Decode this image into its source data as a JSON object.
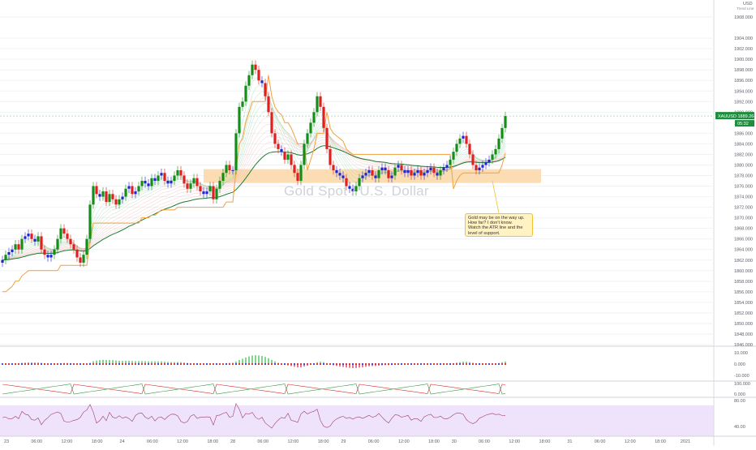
{
  "chart_data": {
    "type": "candlestick",
    "symbol": "XAUUSD",
    "watermark": "Gold Spot / U.S. Dollar",
    "currency": "USD",
    "mode_label": "Trend Line",
    "last_price": "1889.264",
    "countdown": "05:32",
    "ylim": [
      1846,
      1910
    ],
    "y_ticks": [
      "1908.000",
      "1904.000",
      "1902.000",
      "1900.000",
      "1898.000",
      "1896.000",
      "1894.000",
      "1892.000",
      "1890.000",
      "1888.000",
      "1886.000",
      "1884.000",
      "1882.000",
      "1880.000",
      "1878.000",
      "1876.000",
      "1874.000",
      "1872.000",
      "1870.000",
      "1868.000",
      "1866.000",
      "1864.000",
      "1862.000",
      "1860.000",
      "1858.000",
      "1856.000",
      "1854.000",
      "1852.000",
      "1850.000",
      "1848.000",
      "1846.000"
    ],
    "x_ticks": [
      {
        "label": "23",
        "i": 0
      },
      {
        "label": "06:00",
        "i": 12
      },
      {
        "label": "12:00",
        "i": 24
      },
      {
        "label": "18:00",
        "i": 36
      },
      {
        "label": "24",
        "i": 46
      },
      {
        "label": "06:00",
        "i": 58
      },
      {
        "label": "12:00",
        "i": 70
      },
      {
        "label": "18:00",
        "i": 82
      },
      {
        "label": "28",
        "i": 90
      },
      {
        "label": "06:00",
        "i": 102
      },
      {
        "label": "12:00",
        "i": 114
      },
      {
        "label": "18:00",
        "i": 126
      },
      {
        "label": "29",
        "i": 134
      },
      {
        "label": "06:00",
        "i": 146
      },
      {
        "label": "12:00",
        "i": 158
      },
      {
        "label": "18:00",
        "i": 170
      },
      {
        "label": "30",
        "i": 178
      },
      {
        "label": "06:00",
        "i": 190
      },
      {
        "label": "12:00",
        "i": 202
      },
      {
        "label": "18:00",
        "i": 214
      },
      {
        "label": "31",
        "i": 224
      },
      {
        "label": "06:00",
        "i": 236
      },
      {
        "label": "12:00",
        "i": 248
      },
      {
        "label": "18:00",
        "i": 260
      },
      {
        "label": "2021",
        "i": 270
      },
      {
        "label": "06:00",
        "i": 282
      }
    ],
    "closes": [
      1862,
      1863,
      1863.5,
      1864,
      1865,
      1864,
      1866,
      1866.5,
      1867,
      1866,
      1865.5,
      1866.5,
      1864,
      1863,
      1862.5,
      1863,
      1864,
      1866,
      1868,
      1867,
      1866,
      1865,
      1864,
      1862.5,
      1861.5,
      1863,
      1866,
      1872.5,
      1876,
      1874.5,
      1874,
      1875,
      1873,
      1874.5,
      1873.5,
      1872.5,
      1873.5,
      1874,
      1875.5,
      1876,
      1874.5,
      1875,
      1876,
      1877,
      1876.5,
      1876,
      1877.5,
      1877,
      1878,
      1878.5,
      1877,
      1876.5,
      1877,
      1878,
      1879,
      1878,
      1876.5,
      1875.5,
      1876.5,
      1877.5,
      1876,
      1875,
      1874.5,
      1875,
      1876,
      1873.5,
      1875.5,
      1877,
      1878.5,
      1880,
      1879,
      1879,
      1886,
      1891,
      1892,
      1895,
      1897,
      1899,
      1898,
      1896,
      1895.5,
      1893,
      1890,
      1886,
      1884,
      1883,
      1882.5,
      1881,
      1882,
      1880,
      1878.5,
      1877,
      1880,
      1884,
      1886,
      1888,
      1890,
      1893,
      1891,
      1887,
      1883,
      1880,
      1879,
      1878.5,
      1878,
      1877.5,
      1876,
      1875.5,
      1875,
      1876,
      1877.5,
      1878,
      1878.5,
      1879,
      1878,
      1877.5,
      1879,
      1879.5,
      1879,
      1877.5,
      1878,
      1879.5,
      1880,
      1879,
      1878.5,
      1879,
      1878,
      1878.5,
      1879,
      1878,
      1878.5,
      1879,
      1879.5,
      1878.5,
      1878,
      1879,
      1879.5,
      1880,
      1881,
      1882.5,
      1884,
      1885,
      1885.5,
      1884,
      1882,
      1880,
      1879,
      1879.5,
      1880,
      1880.5,
      1881,
      1882,
      1883,
      1885,
      1887,
      1889.264
    ],
    "indicators": {
      "macd_histogram": "osc",
      "stochastic_levels": [
        "100.000",
        "0.000"
      ],
      "rsi_levels": [
        "80.00",
        "40.00"
      ],
      "macd_levels": [
        "10.000",
        "0.000",
        "-10.000"
      ]
    },
    "annotation": {
      "lines": [
        "Gold may be on the way up.",
        "How far? I don't know.",
        "Watch the ATR line and the",
        "level of support."
      ]
    },
    "colors": {
      "up": "#138e17",
      "down": "#e02020",
      "neutral": "#2323d3",
      "atr": "#f2a13a",
      "support_zone": "#fbd7a6",
      "last_price_badge": "#1e8e3e",
      "rsi_band": "#efe3fb",
      "rsi_line": "#9c3b6e"
    }
  }
}
